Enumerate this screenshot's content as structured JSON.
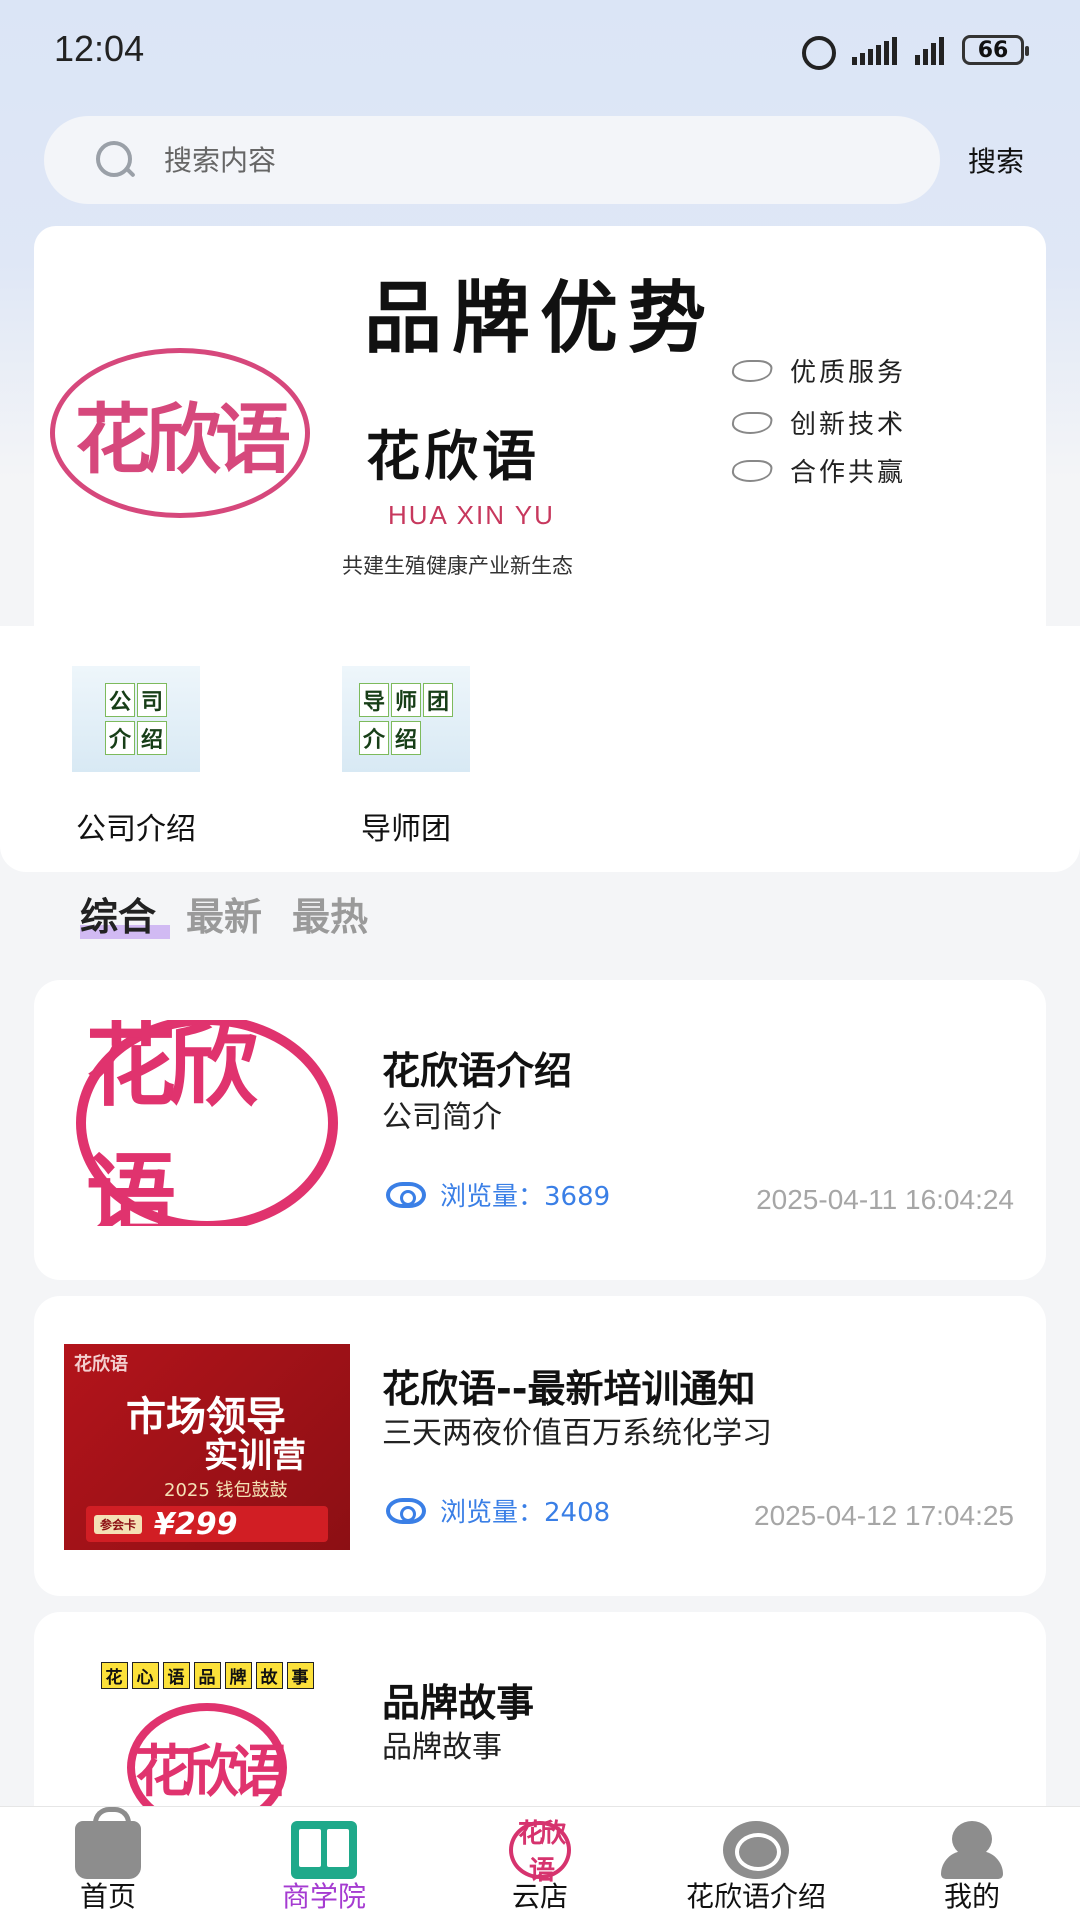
{
  "status_bar": {
    "time": "12:04",
    "battery": "66"
  },
  "search": {
    "placeholder": "搜索内容",
    "button_label": "搜索"
  },
  "banner": {
    "title": "品牌优势",
    "seal_text": "花欣语",
    "brand_name": "花欣语",
    "brand_pinyin": "HUA XIN YU",
    "slogan": "共建生殖健康产业新生态",
    "features": [
      "优质服务",
      "创新技术",
      "合作共赢"
    ]
  },
  "shortcuts": [
    {
      "label": "公司介绍",
      "tile_text": [
        "公",
        "司",
        "介",
        "绍"
      ]
    },
    {
      "label": "导师团",
      "tile_text": [
        "导",
        "师",
        "团",
        "介",
        "绍"
      ]
    }
  ],
  "tabs": [
    "综合",
    "最新",
    "最热"
  ],
  "articles": [
    {
      "title": "花欣语介绍",
      "subtitle": "公司简介",
      "views_label": "浏览量：3689",
      "time": "2025-04-11 16:04:24"
    },
    {
      "title": "花欣语--最新培训通知",
      "subtitle": "三天两夜价值百万系统化学习",
      "views_label": "浏览量：2408",
      "time": "2025-04-12 17:04:25",
      "poster": {
        "logo": "花欣语",
        "title_line1": "市场领导",
        "title_line2": "实训营",
        "sub": "2025 钱包鼓鼓",
        "badge": "参会卡",
        "price": "¥299"
      }
    },
    {
      "title": "品牌故事",
      "subtitle": "品牌故事",
      "poster_tags": [
        "花",
        "心",
        "语",
        "品",
        "牌",
        "故",
        "事"
      ]
    }
  ],
  "bottom_nav": [
    {
      "label": "首页",
      "icon": "bag-icon"
    },
    {
      "label": "商学院",
      "icon": "book-icon",
      "active": true
    },
    {
      "label": "云店",
      "icon": "store-icon"
    },
    {
      "label": "花欣语介绍",
      "icon": "chat-icon"
    },
    {
      "label": "我的",
      "icon": "user-icon"
    }
  ],
  "colors": {
    "accent": "#a53bd1",
    "brand_pink": "#e0336e",
    "link_blue": "#3a7fe6"
  }
}
